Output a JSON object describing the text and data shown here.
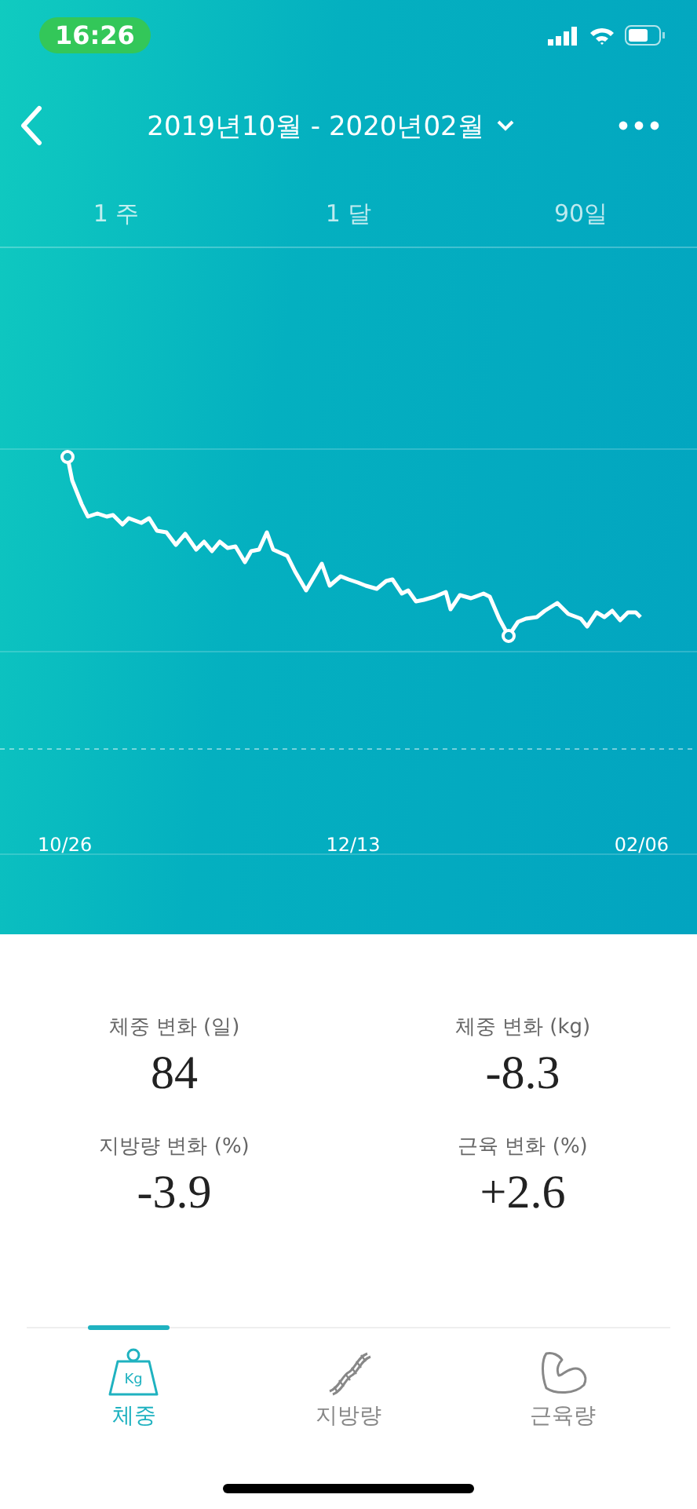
{
  "status_bar": {
    "time": "16:26"
  },
  "header": {
    "title": "2019년10월 - 2020년02월"
  },
  "periods": [
    {
      "label": "1 주"
    },
    {
      "label": "1 달"
    },
    {
      "label": "90일"
    }
  ],
  "chart": {
    "x_labels": [
      "10/26",
      "12/13",
      "02/06"
    ]
  },
  "stats": [
    {
      "label": "체중 변화 (일)",
      "value": "84"
    },
    {
      "label": "체중 변화 (kg)",
      "value": "-8.3"
    },
    {
      "label": "지방량 변화 (%)",
      "value": "-3.9"
    },
    {
      "label": "근육 변화 (%)",
      "value": "+2.6"
    }
  ],
  "tabs": [
    {
      "label": "체중",
      "kind": "weight",
      "icon_text": "Kg",
      "selected": true
    },
    {
      "label": "지방량",
      "kind": "dna",
      "selected": false
    },
    {
      "label": "근육량",
      "kind": "muscle",
      "selected": false
    }
  ]
}
